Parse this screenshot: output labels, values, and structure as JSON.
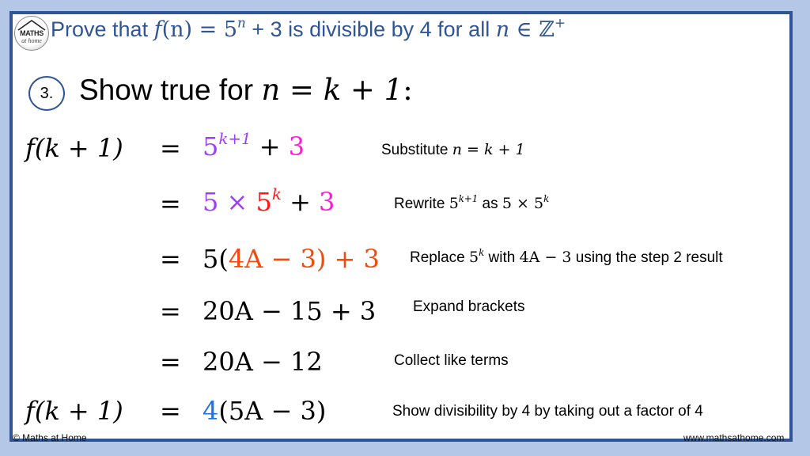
{
  "logo": {
    "line1": "MATHS",
    "line2": "at home"
  },
  "title": {
    "prefix": "Prove that ",
    "func": "f",
    "arg": "(n) = 5",
    "exp": "n",
    "mid": " + 3 is divisible by 4 for all ",
    "var": "n",
    "set": " ∈ ℤ",
    "set_sup": "+"
  },
  "step": {
    "number": "3.",
    "heading_text": "Show true for ",
    "heading_math": "n = k + 1",
    "heading_colon": ":"
  },
  "lines": [
    {
      "lhs": "f(k + 1)",
      "eq": "=",
      "rhs_parts": [
        {
          "text": "5",
          "sup": "k+1",
          "color": "purple"
        },
        {
          "text": " + ",
          "color": "black"
        },
        {
          "text": "3",
          "color": "magenta"
        }
      ],
      "note": "Substitute ",
      "note_math": "n = k + 1"
    },
    {
      "lhs": "",
      "eq": "=",
      "rhs_parts": [
        {
          "text": "5 × ",
          "color": "purple"
        },
        {
          "text": "5",
          "sup": "k",
          "color": "red"
        },
        {
          "text": " + ",
          "color": "black"
        },
        {
          "text": "3",
          "color": "magenta"
        }
      ],
      "note": "Rewrite ",
      "note_math1": "5",
      "note_sup1": "k+1",
      "note_mid": " as ",
      "note_math2": "5 × 5",
      "note_sup2": "k"
    },
    {
      "lhs": "",
      "eq": "=",
      "rhs_parts": [
        {
          "text": "5(",
          "color": "black"
        },
        {
          "text": "4A − 3) + 3",
          "color": "orange"
        }
      ],
      "note": "Replace ",
      "note_math1": "5",
      "note_sup1": "k",
      "note_mid": " with ",
      "note_math2": "4A − 3",
      "note_end": " using the step 2 result"
    },
    {
      "lhs": "",
      "eq": "=",
      "rhs": "20A − 15 + 3",
      "note": "Expand brackets"
    },
    {
      "lhs": "",
      "eq": "=",
      "rhs": "20A − 12",
      "note": "Collect like terms"
    },
    {
      "lhs": "f(k + 1)",
      "eq": "=",
      "rhs_parts": [
        {
          "text": "4",
          "color": "blue"
        },
        {
          "text": "(5A − 3)",
          "color": "black"
        }
      ],
      "note": "Show divisibility by 4 by taking out a factor of 4"
    }
  ],
  "colors": {
    "border": "#2f5597",
    "frame": "#b4c7e7",
    "purple": "#9f3ff8",
    "magenta": "#ff1ad9",
    "red": "#ff1a1a",
    "orange": "#f24a0d",
    "blue": "#1a73e8"
  },
  "footer": {
    "left": "© Maths at Home",
    "right": "www.mathsathome.com"
  }
}
